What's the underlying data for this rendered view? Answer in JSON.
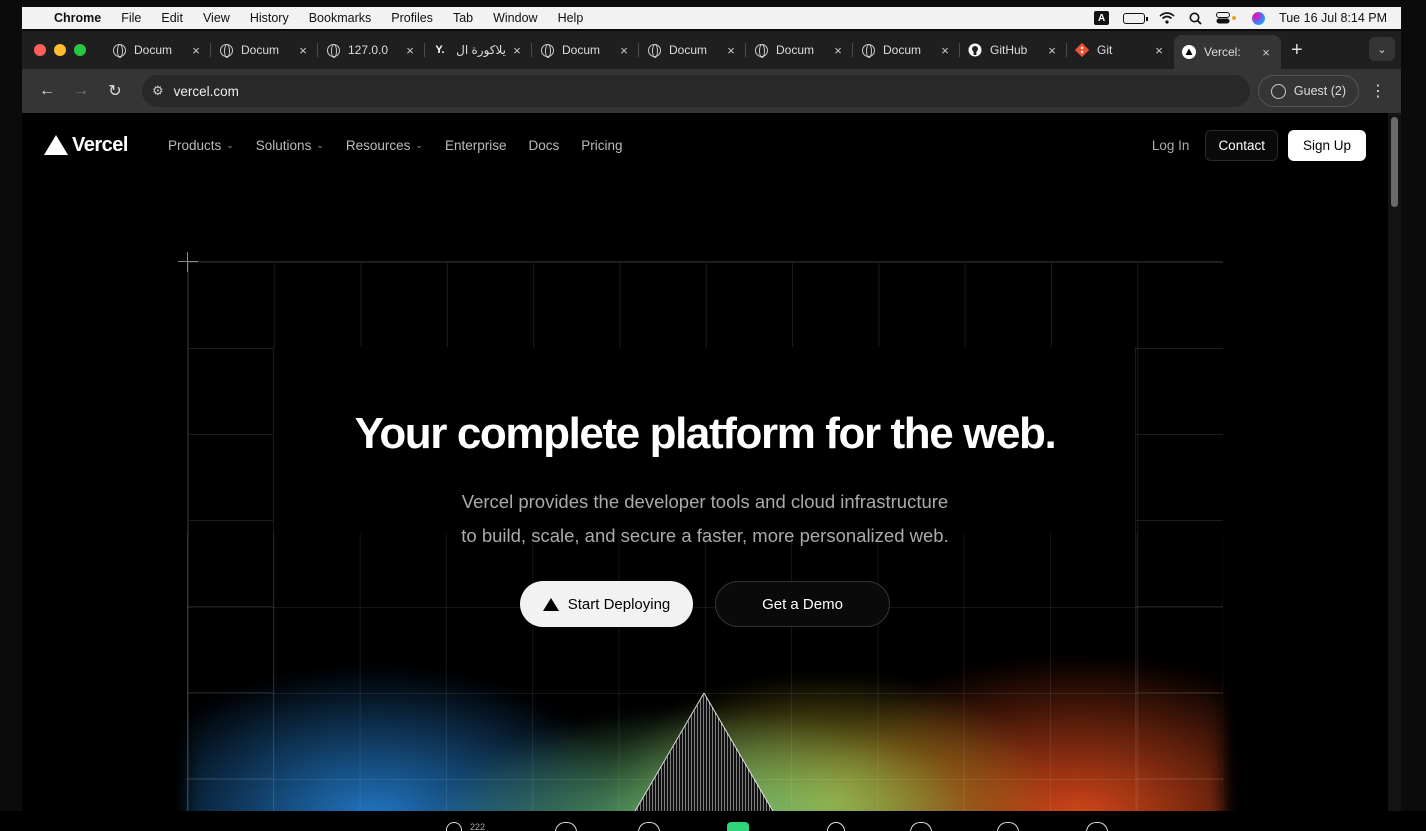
{
  "menubar": {
    "app": "Chrome",
    "items": [
      "File",
      "Edit",
      "View",
      "History",
      "Bookmarks",
      "Profiles",
      "Tab",
      "Window",
      "Help"
    ],
    "input_source": "A",
    "datetime": "Tue 16 Jul  8:14 PM"
  },
  "tabs": [
    {
      "title": "Docum",
      "icon": "globe-icon",
      "close": "×"
    },
    {
      "title": "Docum",
      "icon": "globe-icon",
      "close": "×"
    },
    {
      "title": "127.0.0",
      "icon": "globe-icon",
      "close": "×"
    },
    {
      "title": "يلاكورة ال",
      "icon": "y-logo-icon",
      "favicon_text": "Y.",
      "close": "×"
    },
    {
      "title": "Docum",
      "icon": "globe-icon",
      "close": "×"
    },
    {
      "title": "Docum",
      "icon": "globe-icon",
      "close": "×"
    },
    {
      "title": "Docum",
      "icon": "globe-icon",
      "close": "×"
    },
    {
      "title": "Docum",
      "icon": "globe-icon",
      "close": "×"
    },
    {
      "title": "GitHub",
      "icon": "github-icon",
      "close": "×"
    },
    {
      "title": "Git",
      "icon": "git-icon",
      "close": "×"
    },
    {
      "title": "Vercel:",
      "icon": "vercel-icon",
      "close": "×",
      "active": true
    }
  ],
  "browser": {
    "new_tab": "+",
    "url": "vercel.com",
    "profile_label": "Guest (2)"
  },
  "site": {
    "brand": "Vercel",
    "nav": {
      "products": "Products",
      "solutions": "Solutions",
      "resources": "Resources",
      "enterprise": "Enterprise",
      "docs": "Docs",
      "pricing": "Pricing"
    },
    "login": "Log In",
    "contact": "Contact",
    "signup": "Sign Up",
    "hero": {
      "headline": "Your complete platform for the web.",
      "sub_line1": "Vercel provides the developer tools and cloud infrastructure",
      "sub_line2": "to build, scale, and secure a faster, more personalized web.",
      "cta_primary": "Start Deploying",
      "cta_secondary": "Get a Demo"
    }
  },
  "dock": {
    "badge": "222"
  },
  "colors": {
    "background": "#000000",
    "menubar": "#f2f2f2",
    "accent_green": "#2ed47a"
  }
}
